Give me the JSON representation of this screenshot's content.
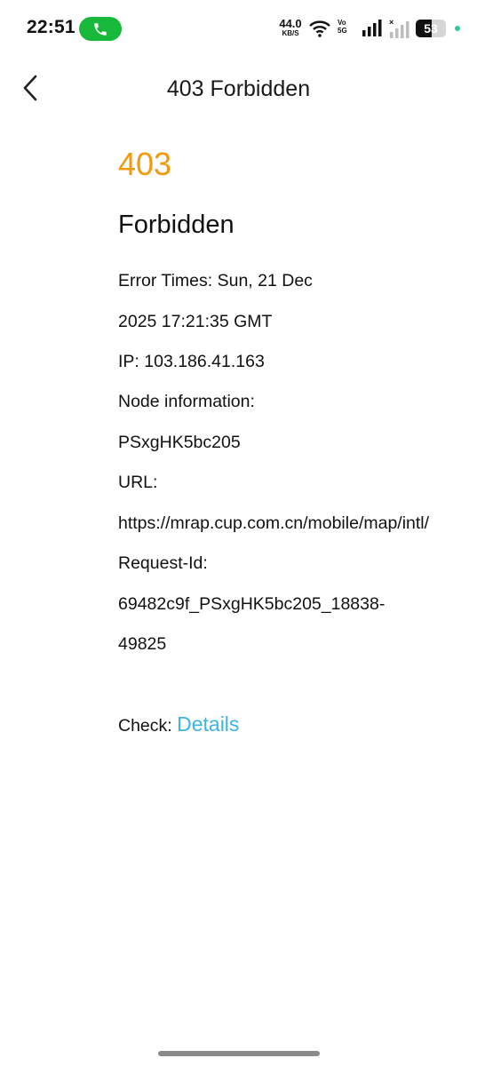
{
  "status_bar": {
    "time": "22:51",
    "net_speed_value": "44.0",
    "net_speed_unit": "KB/S",
    "volte_top": "Vo",
    "volte_bottom": "5G",
    "battery_level": "53",
    "battery_fraction": 0.53,
    "call_color": "#18b83a"
  },
  "header": {
    "title": "403 Forbidden",
    "back_icon": "chevron-left-icon"
  },
  "error": {
    "code": "403",
    "code_color": "#f29a0e",
    "heading": "Forbidden",
    "lines": [
      "Error Times: Sun, 21 Dec",
      "2025 17:21:35 GMT",
      "IP: 103.186.41.163",
      "Node information:",
      "PSxgHK5bc205",
      "URL:",
      "https://mrap.cup.com.cn/mobile/map/intl/",
      "Request-Id:",
      "69482c9f_PSxgHK5bc205_18838-",
      "49825"
    ],
    "check_label": "Check: ",
    "details_link": "Details",
    "link_color": "#3bb4e6"
  }
}
